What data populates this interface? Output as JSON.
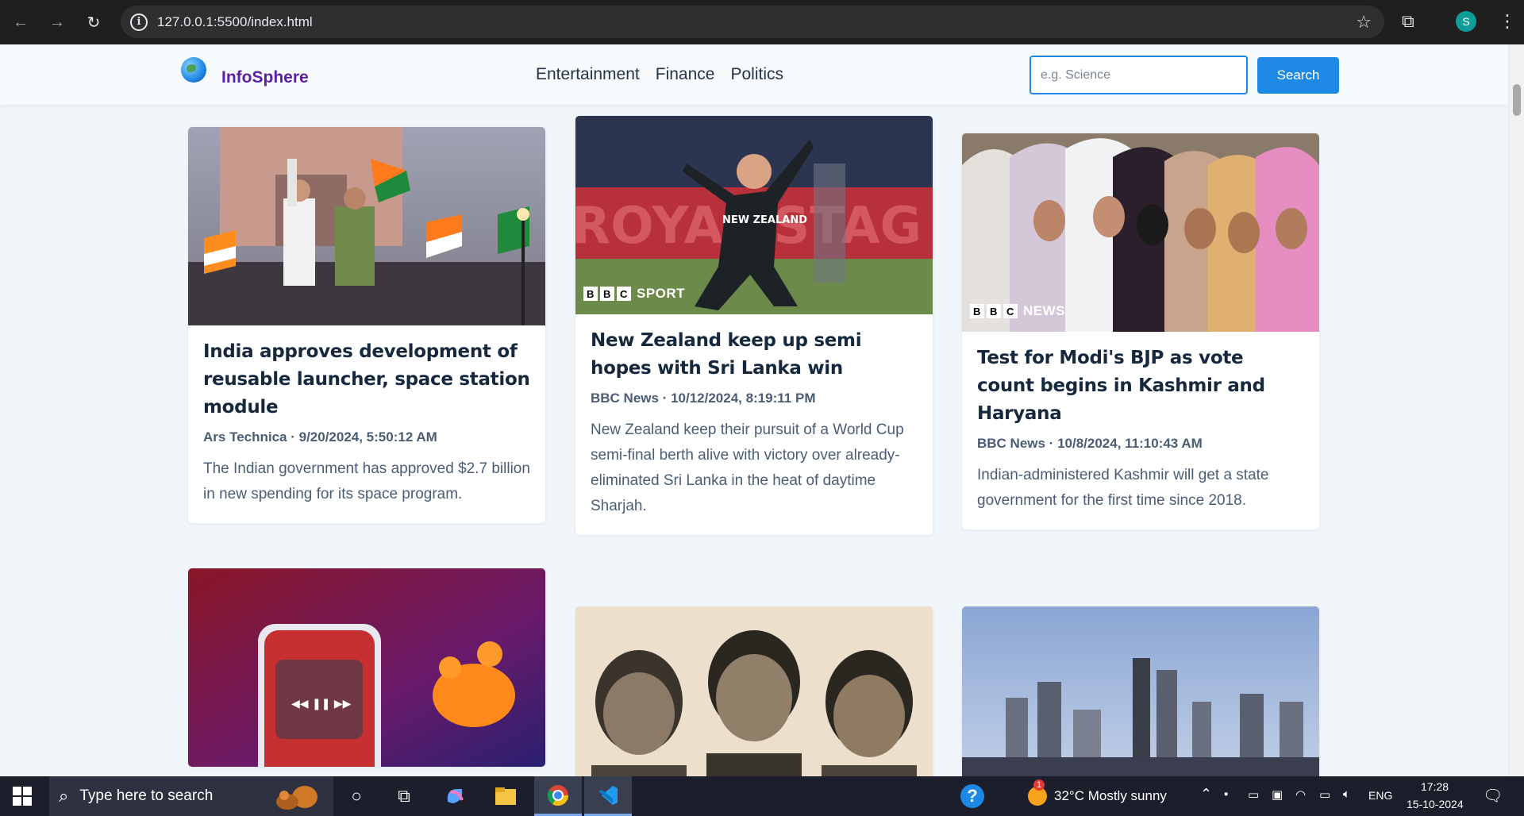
{
  "browser": {
    "url": "127.0.0.1:5500/index.html",
    "profile_initial": "S"
  },
  "site": {
    "brand": "InfoSphere",
    "categories": [
      "Entertainment",
      "Finance",
      "Politics"
    ],
    "search_placeholder": "e.g. Science",
    "search_button": "Search"
  },
  "articles": [
    {
      "title": "India approves development of reusable launcher, space station module",
      "meta": "Ars Technica · 9/20/2024, 5:50:12 AM",
      "description": "The Indian government has approved $2.7 billion in new spending for its space program.",
      "image_icon": "india-celebration-photo"
    },
    {
      "title": "New Zealand keep up semi hopes with Sri Lanka win",
      "meta": "BBC News · 10/12/2024, 8:19:11 PM",
      "description": "New Zealand keep their pursuit of a World Cup semi-final berth alive with victory over already-eliminated Sri Lanka in the heat of daytime Sharjah.",
      "image_icon": "cricket-player-photo",
      "watermark": {
        "letters": [
          "B",
          "B",
          "C"
        ],
        "word": "SPORT"
      }
    },
    {
      "title": "Test for Modi's BJP as vote count begins in Kashmir and Haryana",
      "meta": "BBC News · 10/8/2024, 11:10:43 AM",
      "description": "Indian-administered Kashmir will get a state government for the first time since 2018.",
      "image_icon": "women-queue-photo",
      "watermark": {
        "letters": [
          "B",
          "B",
          "C"
        ],
        "word": "NEWS"
      }
    },
    {
      "image_icon": "phone-earbuds-photo"
    },
    {
      "image_icon": "three-men-portrait-photo"
    },
    {
      "image_icon": "city-skyline-photo"
    }
  ],
  "taskbar": {
    "search_placeholder": "Type here to search",
    "weather": "32°C  Mostly sunny",
    "language": "ENG",
    "time": "17:28",
    "date": "15-10-2024",
    "weather_badge": "1"
  }
}
